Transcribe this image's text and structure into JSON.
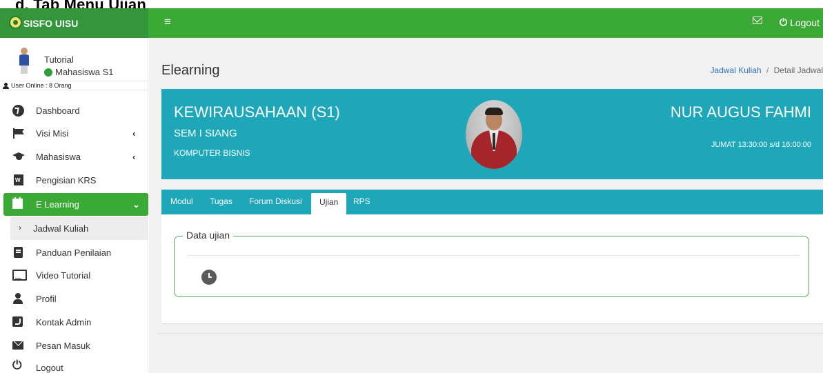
{
  "caption": "d. Tab Menu Ujian",
  "topbar": {
    "brand": "SISFO UISU",
    "menu_toggle": "≡",
    "logout_label": "Logout",
    "power_glyph": "⏻"
  },
  "user": {
    "name": "Tutorial",
    "role": "Mahasiswa S1",
    "online": "User Online : 8 Orang"
  },
  "sidebar": {
    "items": [
      {
        "label": "Dashboard",
        "icon": "dashboard-icon"
      },
      {
        "label": "Visi Misi",
        "icon": "flag-icon",
        "chevron": "‹"
      },
      {
        "label": "Mahasiswa",
        "icon": "graduation-cap-icon",
        "chevron": "‹"
      },
      {
        "label": "Pengisian KRS",
        "icon": "word-file-icon"
      },
      {
        "label": "E Learning",
        "icon": "calendar-icon",
        "chevron": "⌄"
      },
      {
        "label": "Jadwal Kuliah",
        "arrow": "›"
      },
      {
        "label": "Panduan Penilaian",
        "icon": "book-icon"
      },
      {
        "label": "Video Tutorial",
        "icon": "monitor-icon"
      },
      {
        "label": "Profil",
        "icon": "user-icon"
      },
      {
        "label": "Kontak Admin",
        "icon": "contact-icon"
      },
      {
        "label": "Pesan Masuk",
        "icon": "envelope-icon"
      },
      {
        "label": "Logout",
        "icon": "power-icon",
        "glyph": "⏻"
      }
    ]
  },
  "page": {
    "title": "Elearning",
    "breadcrumb": {
      "link": "Jadwal Kuliah",
      "sep": "/",
      "current": "Detail Jadwal"
    }
  },
  "course": {
    "title": "KEWIRAUSAHAAN (S1)",
    "semester": "SEM I SIANG",
    "program": "KOMPUTER BISNIS",
    "lecturer": "NUR AUGUS FAHMI",
    "schedule": "JUMAT 13:30:00 s/d 16:00:00"
  },
  "tabs": [
    "Modul",
    "Tugas",
    "Forum Diskusi",
    "Ujian",
    "RPS"
  ],
  "exam": {
    "legend": "Data ujian"
  },
  "colors": {
    "topbar": "#3aaa35",
    "brand": "#33963a",
    "accent": "#1ea7b9",
    "active_menu": "#3aaa35"
  }
}
